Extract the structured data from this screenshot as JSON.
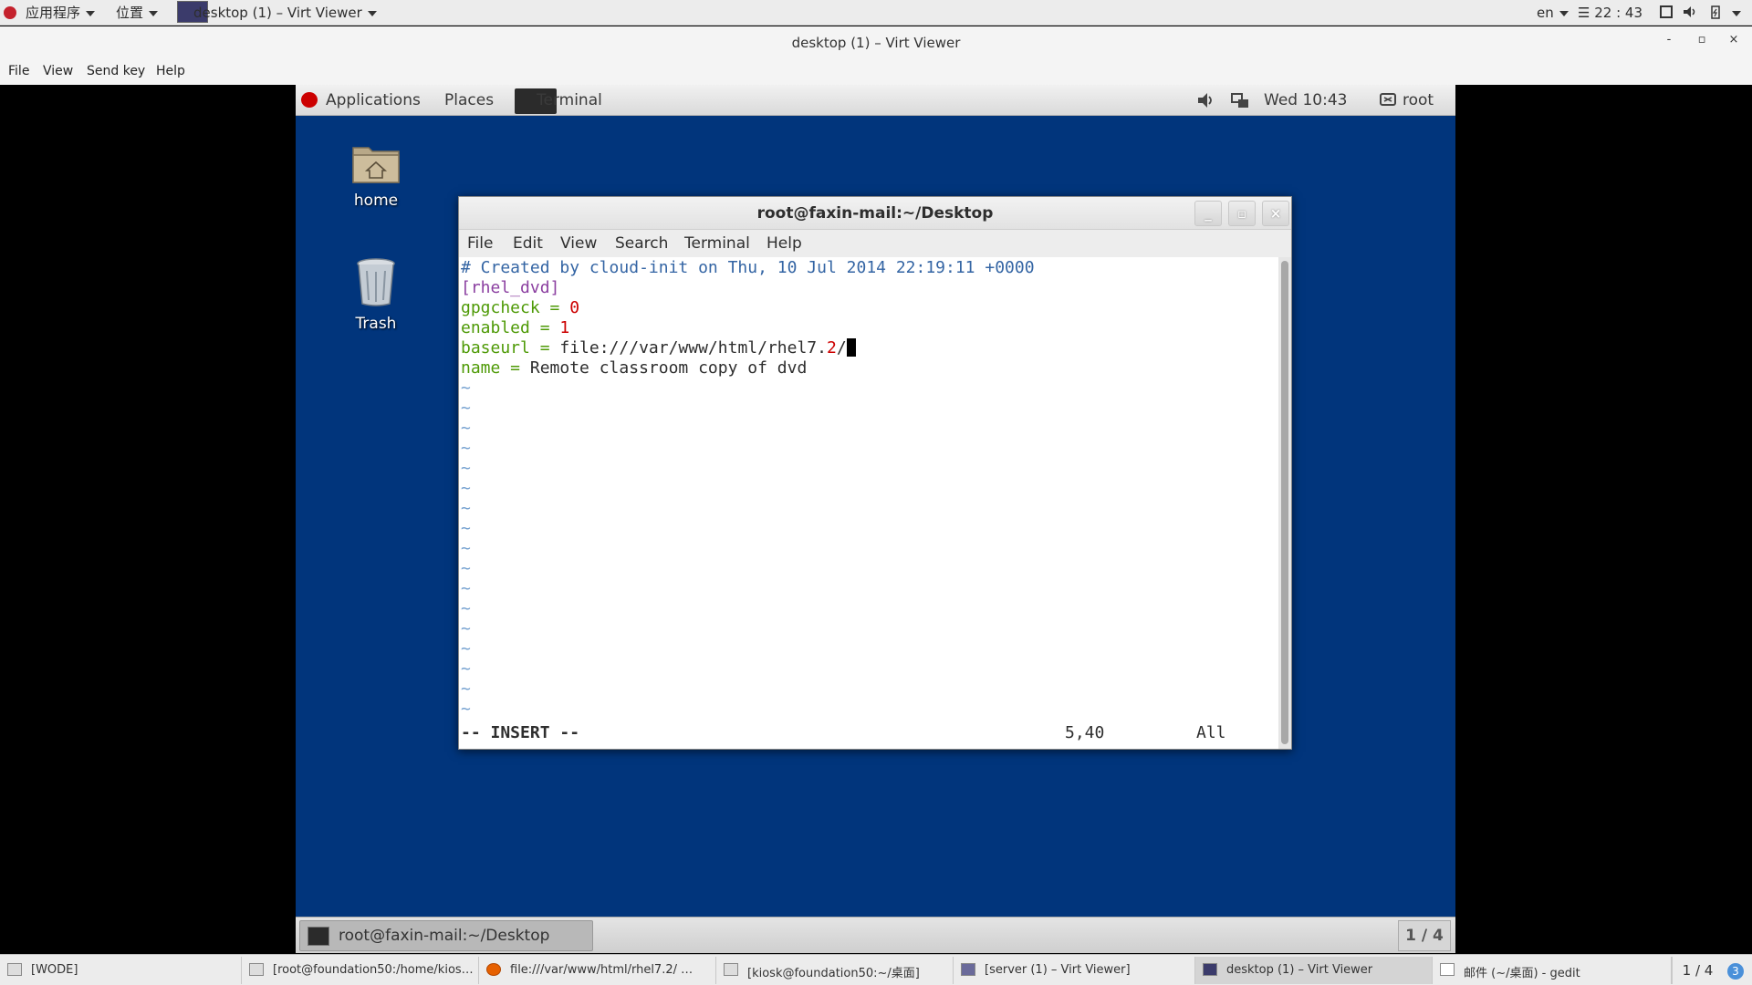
{
  "host_top": {
    "apps": "应用程序",
    "places": "位置",
    "window_label": "desktop (1) – Virt Viewer",
    "lang": "en",
    "clock": "22 : 43"
  },
  "viewer": {
    "title": "desktop (1) – Virt Viewer",
    "menu": [
      "File",
      "View",
      "Send key",
      "Help"
    ],
    "win_controls": [
      "-",
      "▫",
      "×"
    ]
  },
  "guest_panel": {
    "applications": "Applications",
    "places": "Places",
    "terminal": "Terminal",
    "time": "Wed 10:43",
    "user": "root"
  },
  "desktop_icons": [
    "home",
    "Trash"
  ],
  "terminal": {
    "title": "root@faxin-mail:~/Desktop",
    "menu": [
      "File",
      "Edit",
      "View",
      "Search",
      "Terminal",
      "Help"
    ],
    "lines": [
      "# Created by cloud-init on Thu, 10 Jul 2014 22:19:11 +0000",
      "[rhel_dvd]",
      "gpgcheck = 0",
      "enabled = 1",
      "baseurl = file:///var/www/html/rhel7.2/",
      "name = Remote classroom copy of dvd"
    ],
    "tilde": "~",
    "mode": "-- INSERT --",
    "position": "5,40",
    "scroll": "All",
    "colors": {
      "comment": "#3465a4",
      "section": "#8b3fa0",
      "key": "#4e9a06",
      "number": "#cc0000"
    }
  },
  "guest_taskbar": {
    "task": "root@faxin-mail:~/Desktop",
    "pager": "1 / 4"
  },
  "host_taskbar": {
    "items": [
      "[WODE]",
      "[root@foundation50:/home/kios…",
      "file:///var/www/html/rhel7.2/ …",
      "[kiosk@foundation50:~/桌面]",
      "[server (1) – Virt Viewer]",
      "desktop (1) – Virt Viewer",
      "邮件 (~/桌面) - gedit"
    ],
    "pager": "1 / 4",
    "badge": "3"
  }
}
